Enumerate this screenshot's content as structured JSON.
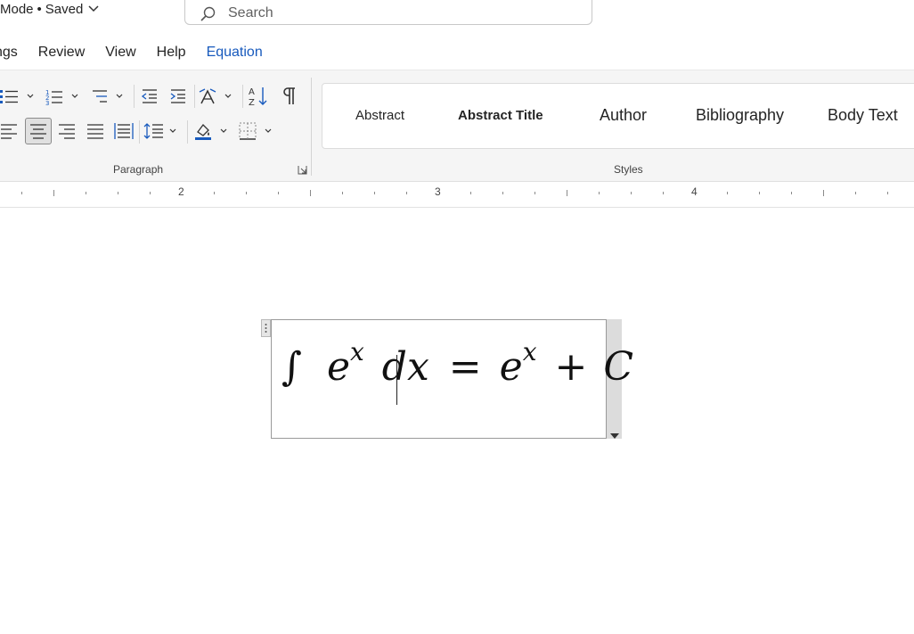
{
  "document": {
    "mode": "Mode",
    "separator": "•",
    "save_status": "Saved"
  },
  "search": {
    "placeholder": "Search"
  },
  "menu": {
    "tabs": [
      {
        "label": "ngs"
      },
      {
        "label": "Review"
      },
      {
        "label": "View"
      },
      {
        "label": "Help"
      },
      {
        "label": "Equation"
      }
    ]
  },
  "ribbon": {
    "paragraph": {
      "label": "Paragraph",
      "buttons": [
        "bullets-icon",
        "numbering-icon",
        "multilevel-list-icon",
        "decrease-indent-icon",
        "increase-indent-icon",
        "text-direction-icon",
        "sort-icon",
        "show-formatting-marks-icon",
        "align-left-icon",
        "align-center-icon",
        "align-right-icon",
        "justify-icon",
        "distributed-icon",
        "line-spacing-icon",
        "shading-icon",
        "borders-icon"
      ]
    },
    "styles": {
      "label": "Styles",
      "items": [
        {
          "label": "Abstract"
        },
        {
          "label": "Abstract Title"
        },
        {
          "label": "Author"
        },
        {
          "label": "Bibliography"
        },
        {
          "label": "Body Text"
        }
      ]
    }
  },
  "ruler": {
    "numbers": [
      "2",
      "3",
      "4"
    ]
  },
  "equation": {
    "integral": "∫",
    "base1": "e",
    "exp1": "x",
    "diff": "dx",
    "equals": "=",
    "base2": "e",
    "exp2": "x",
    "plus": "+",
    "constant": "C"
  },
  "colors": {
    "accent": "#185abd",
    "ribbon_bg": "#f5f5f5",
    "selected_bg": "#e0e0e0"
  }
}
